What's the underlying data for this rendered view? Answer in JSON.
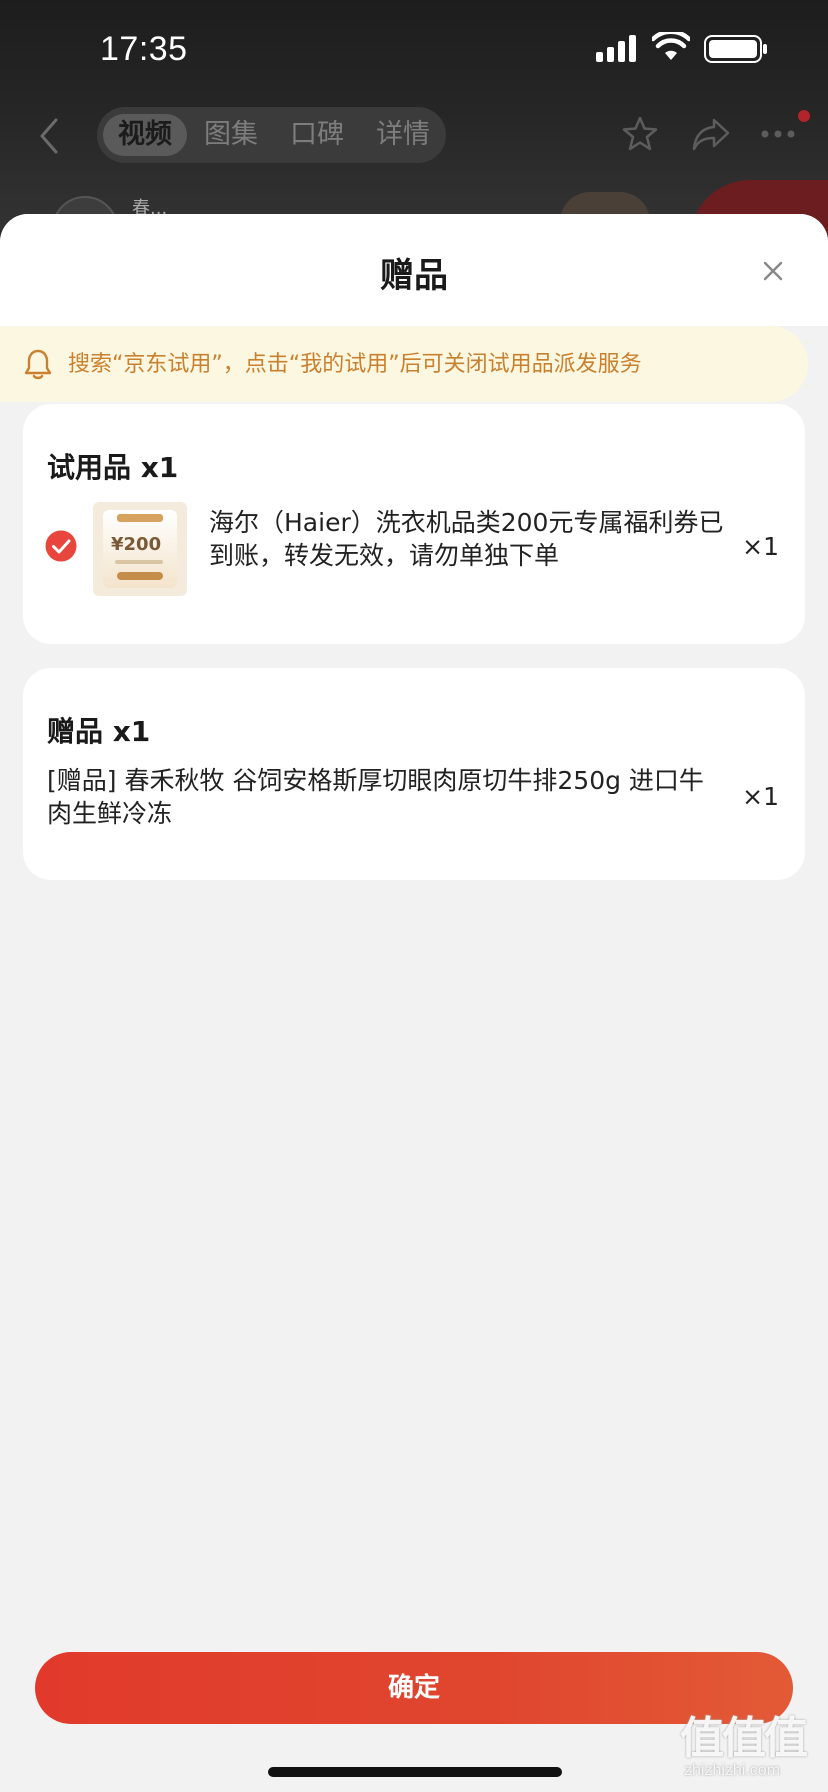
{
  "status_bar": {
    "time": "17:35"
  },
  "top_nav": {
    "tabs": [
      {
        "label": "视频",
        "active": true
      },
      {
        "label": "图集",
        "active": false
      },
      {
        "label": "口碑",
        "active": false
      },
      {
        "label": "详情",
        "active": false
      }
    ],
    "icons": [
      "back-icon",
      "star-icon",
      "share-icon",
      "more-icon"
    ]
  },
  "background": {
    "shop_name": "春..."
  },
  "sheet": {
    "title": "赠品",
    "notice": "搜索“京东试用”，点击“我的试用”后可关闭试用品派发服务",
    "trial_section": {
      "title": "试用品 x1",
      "item": {
        "name": "海尔（Haier）洗衣机品类200元专属福利券已到账，转发无效，请勿单独下单",
        "qty": "×1",
        "checked": true,
        "thumb_value": "¥200"
      }
    },
    "gift_section": {
      "title": "赠品 x1",
      "item": {
        "name": "[赠品] 春禾秋牧 谷饲安格斯厚切眼肉原切牛排250g 进口牛肉生鲜冷冻",
        "qty": "×1"
      }
    },
    "confirm_label": "确定"
  },
  "watermark": {
    "logo": "值值值",
    "url": "zhizhizhi.com"
  },
  "colors": {
    "accent": "#e13a2c",
    "notice_bg": "#fcf7e0",
    "notice_text": "#c9802f"
  }
}
